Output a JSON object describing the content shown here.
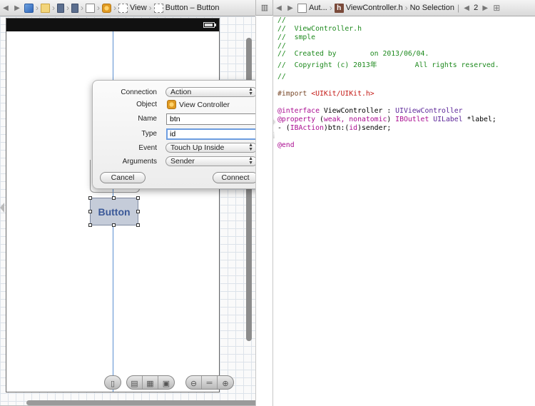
{
  "left_jumpbar": {
    "crumbs": [
      "View",
      "Button – Button"
    ]
  },
  "right_jumpbar": {
    "crumbs": [
      "Aut...",
      "ViewController.h",
      "No Selection"
    ],
    "counter": "2"
  },
  "canvas": {
    "button_title": "Button"
  },
  "popover": {
    "connection_label": "Connection",
    "connection_value": "Action",
    "object_label": "Object",
    "object_value": "View Controller",
    "name_label": "Name",
    "name_value": "btn",
    "type_label": "Type",
    "type_value": "id",
    "event_label": "Event",
    "event_value": "Touch Up Inside",
    "arguments_label": "Arguments",
    "arguments_value": "Sender",
    "cancel_label": "Cancel",
    "connect_label": "Connect"
  },
  "code": {
    "l1": "//",
    "l2": "//  ViewController.h",
    "l3": "//  smple",
    "l4": "//",
    "l5": "//  Created by        on 2013/06/04.",
    "l6": "//  Copyright (c) 2013年         All rights reserved.",
    "l7": "//",
    "import_kw": "#import ",
    "import_path": "<UIKit/UIKit.h>",
    "iface_kw": "@interface",
    "iface_name": " ViewController : ",
    "iface_super": "UIViewController",
    "prop_kw": "@property",
    "prop_open": " (",
    "prop_attrs": "weak, nonatomic",
    "prop_close": ") ",
    "prop_outlet": "IBOutlet",
    "prop_sp": " ",
    "prop_type": "UILabel",
    "prop_var": " *label;",
    "action_dash": "- (",
    "action_kw": "IBAction",
    "action_rest": ")btn:(",
    "action_id": "id",
    "action_end": ")sender;",
    "end_kw": "@end"
  }
}
